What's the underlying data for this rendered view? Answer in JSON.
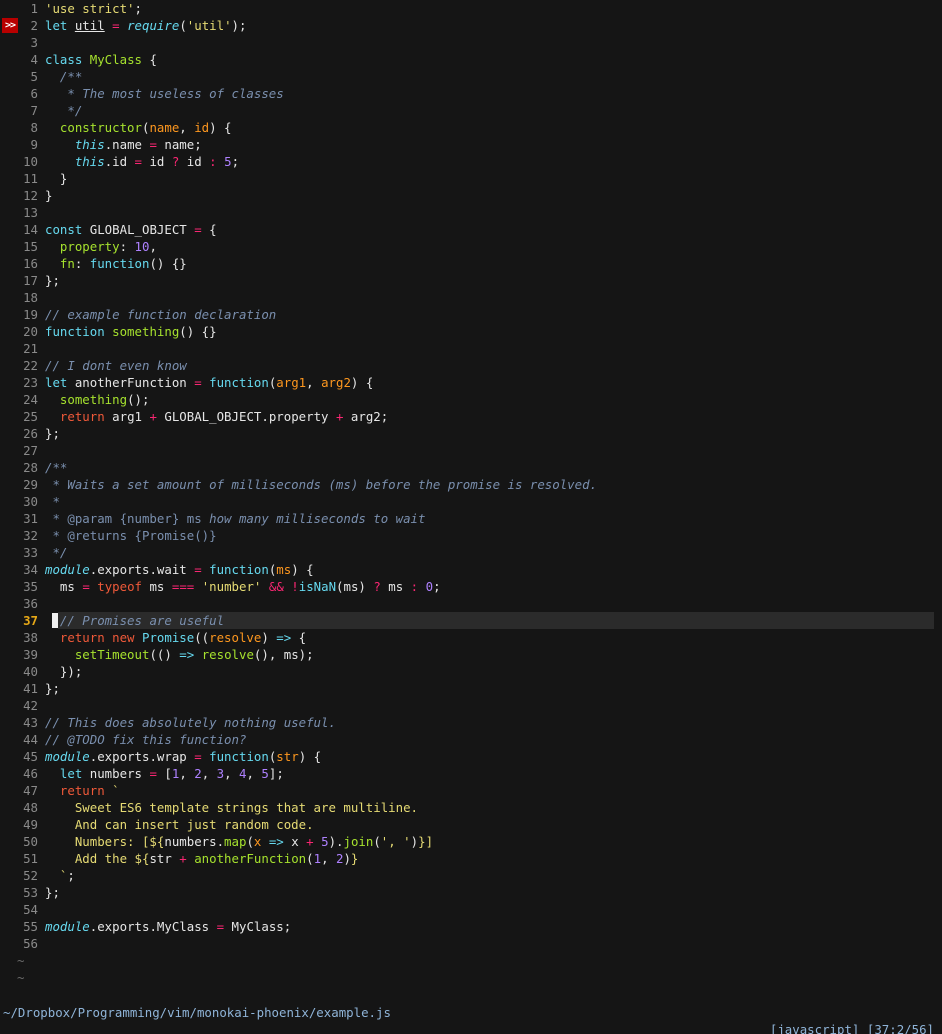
{
  "editor": {
    "sign_text": ">>",
    "current_line": 37,
    "lines": [
      {
        "n": "1",
        "tokens": [
          [
            "str",
            "'use strict'"
          ],
          [
            "plain",
            ";"
          ]
        ]
      },
      {
        "n": "2",
        "sign": true,
        "tokens": [
          [
            "decl",
            "let "
          ],
          [
            "ul",
            "util"
          ],
          [
            "plain",
            " "
          ],
          [
            "op",
            "="
          ],
          [
            "plain",
            " "
          ],
          [
            "this",
            "require"
          ],
          [
            "plain",
            "("
          ],
          [
            "str",
            "'util'"
          ],
          [
            "plain",
            ");"
          ]
        ]
      },
      {
        "n": "3",
        "tokens": []
      },
      {
        "n": "4",
        "tokens": [
          [
            "decl",
            "class "
          ],
          [
            "type",
            "MyClass"
          ],
          [
            "plain",
            " {"
          ]
        ]
      },
      {
        "n": "5",
        "tokens": [
          [
            "plain",
            "  "
          ],
          [
            "cmt",
            "/**"
          ]
        ]
      },
      {
        "n": "6",
        "tokens": [
          [
            "plain",
            "   "
          ],
          [
            "cmt",
            "* The most useless of classes"
          ]
        ]
      },
      {
        "n": "7",
        "tokens": [
          [
            "plain",
            "   "
          ],
          [
            "cmt",
            "*/"
          ]
        ]
      },
      {
        "n": "8",
        "tokens": [
          [
            "plain",
            "  "
          ],
          [
            "fn",
            "constructor"
          ],
          [
            "plain",
            "("
          ],
          [
            "param",
            "name"
          ],
          [
            "plain",
            ", "
          ],
          [
            "param",
            "id"
          ],
          [
            "plain",
            ") {"
          ]
        ]
      },
      {
        "n": "9",
        "tokens": [
          [
            "plain",
            "    "
          ],
          [
            "this",
            "this"
          ],
          [
            "plain",
            ".name "
          ],
          [
            "op",
            "="
          ],
          [
            "plain",
            " name;"
          ]
        ]
      },
      {
        "n": "10",
        "tokens": [
          [
            "plain",
            "    "
          ],
          [
            "this",
            "this"
          ],
          [
            "plain",
            ".id "
          ],
          [
            "op",
            "="
          ],
          [
            "plain",
            " id "
          ],
          [
            "op",
            "?"
          ],
          [
            "plain",
            " id "
          ],
          [
            "op",
            ":"
          ],
          [
            "plain",
            " "
          ],
          [
            "num",
            "5"
          ],
          [
            "plain",
            ";"
          ]
        ]
      },
      {
        "n": "11",
        "tokens": [
          [
            "plain",
            "  }"
          ]
        ]
      },
      {
        "n": "12",
        "tokens": [
          [
            "plain",
            "}"
          ]
        ]
      },
      {
        "n": "13",
        "tokens": []
      },
      {
        "n": "14",
        "tokens": [
          [
            "decl",
            "const "
          ],
          [
            "plain",
            "GLOBAL_OBJECT "
          ],
          [
            "op",
            "="
          ],
          [
            "plain",
            " {"
          ]
        ]
      },
      {
        "n": "15",
        "tokens": [
          [
            "plain",
            "  "
          ],
          [
            "fn",
            "property"
          ],
          [
            "plain",
            ": "
          ],
          [
            "num",
            "10"
          ],
          [
            "plain",
            ","
          ]
        ]
      },
      {
        "n": "16",
        "tokens": [
          [
            "plain",
            "  "
          ],
          [
            "fn",
            "fn"
          ],
          [
            "plain",
            ": "
          ],
          [
            "decl",
            "function"
          ],
          [
            "plain",
            "() {}"
          ]
        ]
      },
      {
        "n": "17",
        "tokens": [
          [
            "plain",
            "};"
          ]
        ]
      },
      {
        "n": "18",
        "tokens": []
      },
      {
        "n": "19",
        "tokens": [
          [
            "cmt",
            "// example function declaration"
          ]
        ]
      },
      {
        "n": "20",
        "tokens": [
          [
            "decl",
            "function "
          ],
          [
            "fn",
            "something"
          ],
          [
            "plain",
            "() {}"
          ]
        ]
      },
      {
        "n": "21",
        "tokens": []
      },
      {
        "n": "22",
        "tokens": [
          [
            "cmt",
            "// I dont even know"
          ]
        ]
      },
      {
        "n": "23",
        "tokens": [
          [
            "decl",
            "let "
          ],
          [
            "plain",
            "anotherFunction "
          ],
          [
            "op",
            "="
          ],
          [
            "plain",
            " "
          ],
          [
            "decl",
            "function"
          ],
          [
            "plain",
            "("
          ],
          [
            "param",
            "arg1"
          ],
          [
            "plain",
            ", "
          ],
          [
            "param",
            "arg2"
          ],
          [
            "plain",
            ") {"
          ]
        ]
      },
      {
        "n": "24",
        "tokens": [
          [
            "plain",
            "  "
          ],
          [
            "fn",
            "something"
          ],
          [
            "plain",
            "();"
          ]
        ]
      },
      {
        "n": "25",
        "tokens": [
          [
            "plain",
            "  "
          ],
          [
            "kw",
            "return"
          ],
          [
            "plain",
            " arg1 "
          ],
          [
            "op",
            "+"
          ],
          [
            "plain",
            " GLOBAL_OBJECT.property "
          ],
          [
            "op",
            "+"
          ],
          [
            "plain",
            " arg2;"
          ]
        ]
      },
      {
        "n": "26",
        "tokens": [
          [
            "plain",
            "};"
          ]
        ]
      },
      {
        "n": "27",
        "tokens": []
      },
      {
        "n": "28",
        "tokens": [
          [
            "cmt",
            "/**"
          ]
        ]
      },
      {
        "n": "29",
        "tokens": [
          [
            "cmt",
            " * Waits a set amount of milliseconds (ms) before the promise is resolved."
          ]
        ]
      },
      {
        "n": "30",
        "tokens": [
          [
            "cmt",
            " *"
          ]
        ]
      },
      {
        "n": "31",
        "tokens": [
          [
            "doc",
            " * @param {number} ms "
          ],
          [
            "cmt",
            "how many milliseconds to wait"
          ]
        ]
      },
      {
        "n": "32",
        "tokens": [
          [
            "doc",
            " * @returns {Promise()}"
          ]
        ]
      },
      {
        "n": "33",
        "tokens": [
          [
            "cmt",
            " */"
          ]
        ]
      },
      {
        "n": "34",
        "tokens": [
          [
            "this",
            "module"
          ],
          [
            "plain",
            ".exports.wait "
          ],
          [
            "op",
            "="
          ],
          [
            "plain",
            " "
          ],
          [
            "decl",
            "function"
          ],
          [
            "plain",
            "("
          ],
          [
            "param",
            "ms"
          ],
          [
            "plain",
            ") {"
          ]
        ]
      },
      {
        "n": "35",
        "tokens": [
          [
            "plain",
            "  ms "
          ],
          [
            "op",
            "="
          ],
          [
            "plain",
            " "
          ],
          [
            "kw",
            "typeof"
          ],
          [
            "plain",
            " ms "
          ],
          [
            "op",
            "==="
          ],
          [
            "plain",
            " "
          ],
          [
            "str",
            "'number'"
          ],
          [
            "plain",
            " "
          ],
          [
            "op",
            "&&"
          ],
          [
            "plain",
            " "
          ],
          [
            "op",
            "!"
          ],
          [
            "decl",
            "isNaN"
          ],
          [
            "plain",
            "(ms) "
          ],
          [
            "op",
            "?"
          ],
          [
            "plain",
            " ms "
          ],
          [
            "op",
            ":"
          ],
          [
            "plain",
            " "
          ],
          [
            "num",
            "0"
          ],
          [
            "plain",
            ";"
          ]
        ]
      },
      {
        "n": "36",
        "tokens": []
      },
      {
        "n": "37",
        "current": true,
        "tokens": [
          [
            "plain",
            "  "
          ],
          [
            "cmt",
            "// Promises are useful"
          ]
        ]
      },
      {
        "n": "38",
        "tokens": [
          [
            "plain",
            "  "
          ],
          [
            "kw",
            "return new "
          ],
          [
            "decl",
            "Promise"
          ],
          [
            "plain",
            "(("
          ],
          [
            "param",
            "resolve"
          ],
          [
            "plain",
            ") "
          ],
          [
            "decl",
            "=>"
          ],
          [
            "plain",
            " {"
          ]
        ]
      },
      {
        "n": "39",
        "tokens": [
          [
            "plain",
            "    "
          ],
          [
            "fn",
            "setTimeout"
          ],
          [
            "plain",
            "(() "
          ],
          [
            "decl",
            "=>"
          ],
          [
            "plain",
            " "
          ],
          [
            "fn",
            "resolve"
          ],
          [
            "plain",
            "(), ms);"
          ]
        ]
      },
      {
        "n": "40",
        "tokens": [
          [
            "plain",
            "  });"
          ]
        ]
      },
      {
        "n": "41",
        "tokens": [
          [
            "plain",
            "};"
          ]
        ]
      },
      {
        "n": "42",
        "tokens": []
      },
      {
        "n": "43",
        "tokens": [
          [
            "cmt",
            "// This does absolutely nothing useful."
          ]
        ]
      },
      {
        "n": "44",
        "tokens": [
          [
            "cmt",
            "// @TODO fix this function?"
          ]
        ]
      },
      {
        "n": "45",
        "tokens": [
          [
            "this",
            "module"
          ],
          [
            "plain",
            ".exports.wrap "
          ],
          [
            "op",
            "="
          ],
          [
            "plain",
            " "
          ],
          [
            "decl",
            "function"
          ],
          [
            "plain",
            "("
          ],
          [
            "param",
            "str"
          ],
          [
            "plain",
            ") {"
          ]
        ]
      },
      {
        "n": "46",
        "tokens": [
          [
            "plain",
            "  "
          ],
          [
            "decl",
            "let "
          ],
          [
            "plain",
            "numbers "
          ],
          [
            "op",
            "="
          ],
          [
            "plain",
            " ["
          ],
          [
            "num",
            "1"
          ],
          [
            "plain",
            ", "
          ],
          [
            "num",
            "2"
          ],
          [
            "plain",
            ", "
          ],
          [
            "num",
            "3"
          ],
          [
            "plain",
            ", "
          ],
          [
            "num",
            "4"
          ],
          [
            "plain",
            ", "
          ],
          [
            "num",
            "5"
          ],
          [
            "plain",
            "];"
          ]
        ]
      },
      {
        "n": "47",
        "tokens": [
          [
            "plain",
            "  "
          ],
          [
            "kw",
            "return"
          ],
          [
            "plain",
            " "
          ],
          [
            "str",
            "`"
          ]
        ]
      },
      {
        "n": "48",
        "tokens": [
          [
            "tpl",
            "    Sweet ES6 template strings that are multiline."
          ]
        ]
      },
      {
        "n": "49",
        "tokens": [
          [
            "tpl",
            "    And can insert just random code."
          ]
        ]
      },
      {
        "n": "50",
        "tokens": [
          [
            "tpl",
            "    Numbers: [${"
          ],
          [
            "plain",
            "numbers."
          ],
          [
            "fn",
            "map"
          ],
          [
            "plain",
            "("
          ],
          [
            "param",
            "x"
          ],
          [
            "plain",
            " "
          ],
          [
            "decl",
            "=>"
          ],
          [
            "plain",
            " x "
          ],
          [
            "op",
            "+"
          ],
          [
            "plain",
            " "
          ],
          [
            "num",
            "5"
          ],
          [
            "plain",
            ")."
          ],
          [
            "fn",
            "join"
          ],
          [
            "plain",
            "("
          ],
          [
            "str",
            "', '"
          ],
          [
            "plain",
            ")"
          ],
          [
            "tpl",
            "}]"
          ]
        ]
      },
      {
        "n": "51",
        "tokens": [
          [
            "tpl",
            "    Add the ${"
          ],
          [
            "plain",
            "str "
          ],
          [
            "op",
            "+"
          ],
          [
            "plain",
            " "
          ],
          [
            "fn",
            "anotherFunction"
          ],
          [
            "plain",
            "("
          ],
          [
            "num",
            "1"
          ],
          [
            "plain",
            ", "
          ],
          [
            "num",
            "2"
          ],
          [
            "plain",
            ")"
          ],
          [
            "tpl",
            "}"
          ]
        ]
      },
      {
        "n": "52",
        "tokens": [
          [
            "str",
            "  `"
          ],
          [
            "plain",
            ";"
          ]
        ]
      },
      {
        "n": "53",
        "tokens": [
          [
            "plain",
            "};"
          ]
        ]
      },
      {
        "n": "54",
        "tokens": []
      },
      {
        "n": "55",
        "tokens": [
          [
            "this",
            "module"
          ],
          [
            "plain",
            ".exports.MyClass "
          ],
          [
            "op",
            "="
          ],
          [
            "plain",
            " MyClass;"
          ]
        ]
      },
      {
        "n": "56",
        "tokens": []
      }
    ],
    "empty_line_marker": "~",
    "empty_line_count": 2
  },
  "statusline": {
    "file_path": "~/Dropbox/Programming/vim/monokai-phoenix/example.js",
    "filetype": "[javascript]",
    "position": "[37:2/56]"
  },
  "colors": {
    "background": "#151515",
    "cursorline": "#2b2b2b",
    "sign_bg": "#b80000",
    "line_number": "#8a8a8a",
    "current_line_number": "#e6a817",
    "string": "#e6db74",
    "keyword": "#ef5939",
    "declaration": "#66d9ef",
    "function": "#a6e22e",
    "number": "#ae81ff",
    "comment": "#7a8fae",
    "param": "#fd971f",
    "operator": "#f92672",
    "statusline_text": "#8fb4d8"
  }
}
